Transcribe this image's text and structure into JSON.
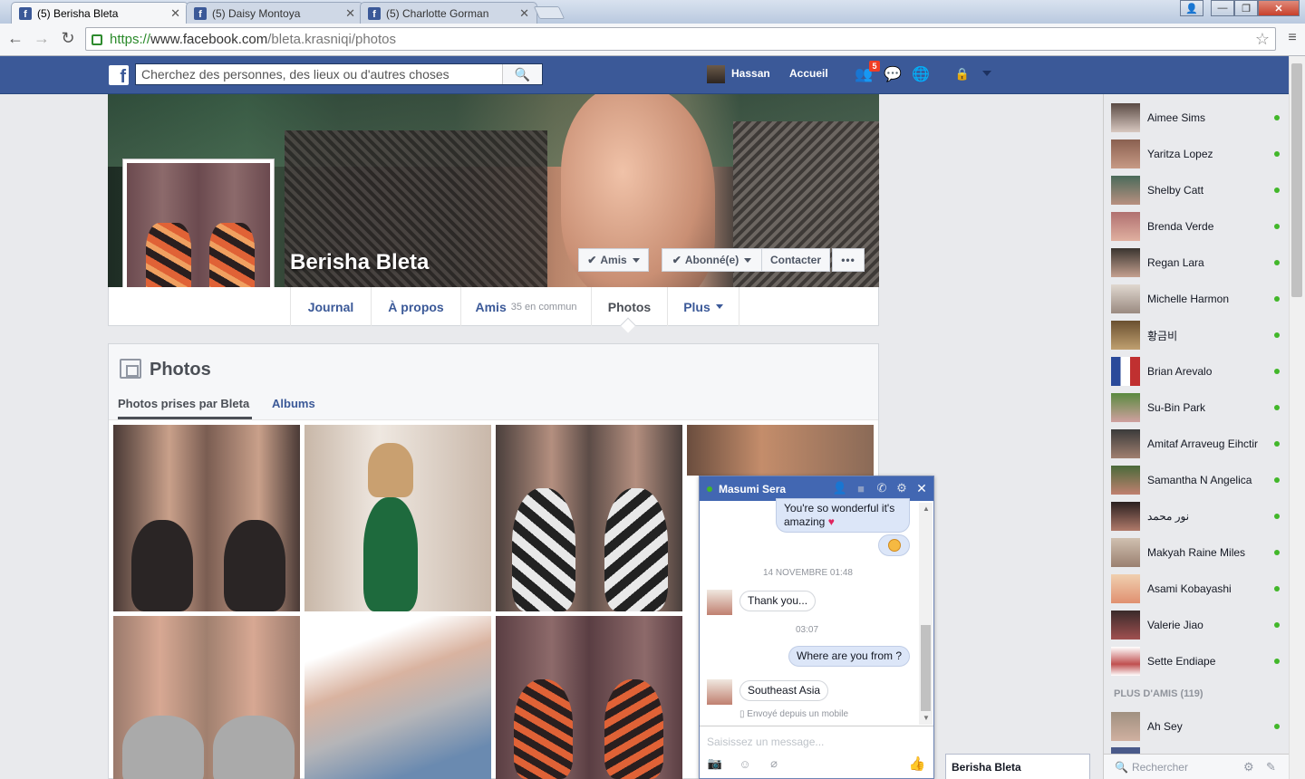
{
  "browser": {
    "tabs": [
      {
        "title": "(5) Berisha Bleta",
        "active": true
      },
      {
        "title": "(5) Daisy Montoya",
        "active": false
      },
      {
        "title": "(5) Charlotte Gorman",
        "active": false
      }
    ],
    "url_scheme": "https://",
    "url_host": "www.facebook.com",
    "url_path": "/bleta.krasniqi/photos"
  },
  "fb_header": {
    "search_placeholder": "Cherchez des personnes, des lieux ou d'autres choses",
    "user_name": "Hassan",
    "home_label": "Accueil",
    "friend_requests_count": "5"
  },
  "profile": {
    "name": "Berisha Bleta",
    "buttons": {
      "friends": "Amis",
      "following": "Abonné(e)",
      "message": "Contacter",
      "more": "•••"
    },
    "tabs": {
      "timeline": "Journal",
      "about": "À propos",
      "friends": "Amis",
      "friends_common": "35 en commun",
      "photos": "Photos",
      "more": "Plus"
    }
  },
  "photos_section": {
    "title": "Photos",
    "tab_taken": "Photos prises par Bleta",
    "tab_albums": "Albums"
  },
  "chat_sidebar": {
    "friends": [
      "Aimee Sims",
      "Yaritza Lopez",
      "Shelby Catt",
      "Brenda Verde",
      "Regan Lara",
      "Michelle Harmon",
      "황금비",
      "Brian Arevalo",
      "Su-Bin Park",
      "Amitaf Arraveug Eihctir",
      "Samantha N Angelica",
      "نور محمد",
      "Makyah Raine Miles",
      "Asami Kobayashi",
      "Valerie Jiao",
      "Sette Endiape"
    ],
    "more_friends": "PLUS D'AMIS (119)",
    "more_friends_list": [
      "Ah Sey"
    ],
    "search_placeholder": "Rechercher"
  },
  "chat_window": {
    "contact": "Masumi Sera",
    "messages": {
      "m1": "You're so wonderful it's amazing",
      "date1": "14 NOVEMBRE 01:48",
      "m2": "Thank you...",
      "time2": "03:07",
      "m3": "Where are you from ?",
      "m4": "Southeast Asia",
      "sent_from": "Envoyé depuis un mobile"
    },
    "input_placeholder": "Saisissez un message..."
  },
  "minimized_chat": "Berisha Bleta",
  "colors": {
    "fb_blue": "#3b5998",
    "online_green": "#42b72a",
    "link_blue": "#3b5998"
  }
}
